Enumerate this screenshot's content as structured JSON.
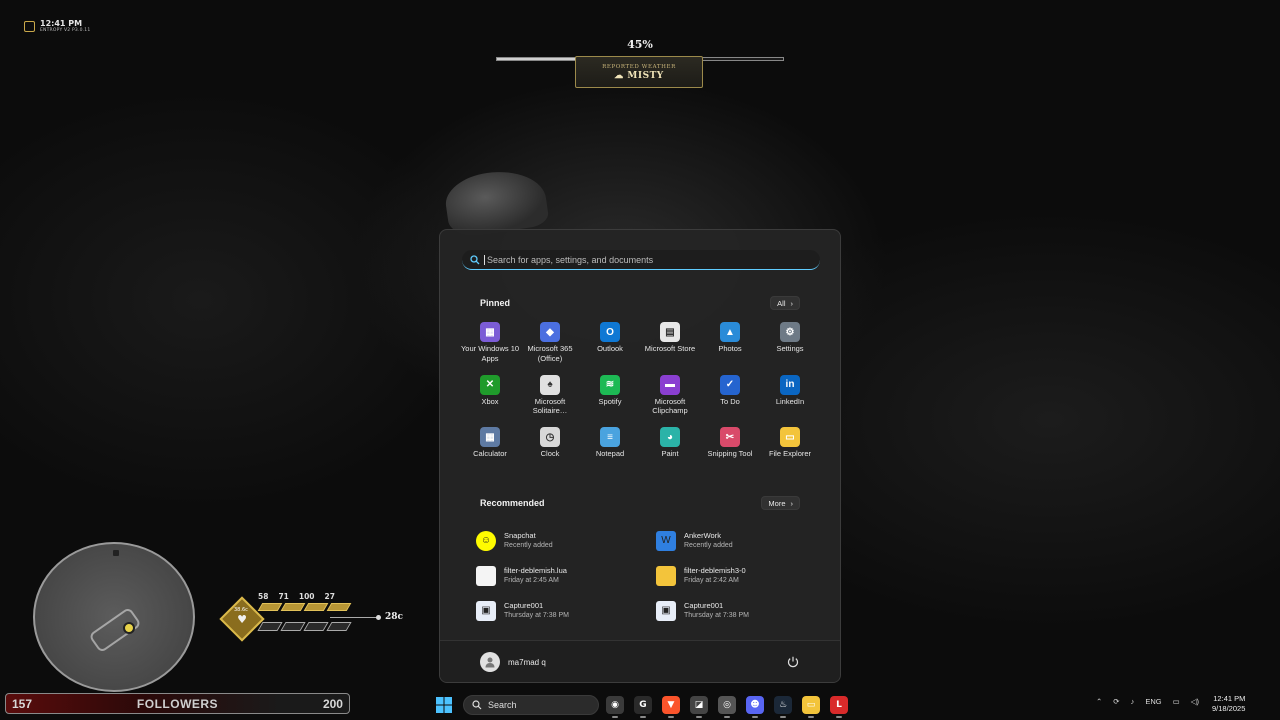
{
  "hud": {
    "time": "12:41 PM",
    "time_sub": "ENTROPY V2 P3.0.11",
    "objective_percent": "45%",
    "objective_progress": 0.45,
    "weather_caption": "REPORTED WEATHER",
    "weather_value": "MISTY",
    "minimap_temp": "38.6c",
    "stats": [
      "58",
      "71",
      "100",
      "27"
    ],
    "temperature": "28c",
    "followers_left": "157",
    "followers_label": "FOLLOWERS",
    "followers_right": "200"
  },
  "start_menu": {
    "search_placeholder": "Search for apps, settings, and documents",
    "pinned_title": "Pinned",
    "all_button": "All",
    "pinned": [
      {
        "label": "Your Windows 10 Apps",
        "icon": "windows-apps-icon",
        "color": "#7b5cd6",
        "glyph": "▦"
      },
      {
        "label": "Microsoft 365 (Office)",
        "icon": "m365-icon",
        "color": "#4b6fe0",
        "glyph": "◆"
      },
      {
        "label": "Outlook",
        "icon": "outlook-icon",
        "color": "#0f78d4",
        "glyph": "O"
      },
      {
        "label": "Microsoft Store",
        "icon": "store-icon",
        "color": "#e8e8e8",
        "glyph": "▤"
      },
      {
        "label": "Photos",
        "icon": "photos-icon",
        "color": "#2a8bd8",
        "glyph": "▲"
      },
      {
        "label": "Settings",
        "icon": "gear-icon",
        "color": "#6e7a86",
        "glyph": "⚙"
      },
      {
        "label": "Xbox",
        "icon": "xbox-icon",
        "color": "#1f9b2b",
        "glyph": "✕"
      },
      {
        "label": "Microsoft Solitaire…",
        "icon": "solitaire-icon",
        "color": "#e0e0e0",
        "glyph": "♠"
      },
      {
        "label": "Spotify",
        "icon": "spotify-icon",
        "color": "#1db954",
        "glyph": "≋"
      },
      {
        "label": "Microsoft Clipchamp",
        "icon": "clipchamp-icon",
        "color": "#8a3fd1",
        "glyph": "▬"
      },
      {
        "label": "To Do",
        "icon": "todo-icon",
        "color": "#2564cf",
        "glyph": "✓"
      },
      {
        "label": "LinkedIn",
        "icon": "linkedin-icon",
        "color": "#0a66c2",
        "glyph": "in"
      },
      {
        "label": "Calculator",
        "icon": "calculator-icon",
        "color": "#5e7aa3",
        "glyph": "▦"
      },
      {
        "label": "Clock",
        "icon": "clock-icon",
        "color": "#d8d8d8",
        "glyph": "◷"
      },
      {
        "label": "Notepad",
        "icon": "notepad-icon",
        "color": "#4aa3df",
        "glyph": "≡"
      },
      {
        "label": "Paint",
        "icon": "paint-icon",
        "color": "#2bb3a8",
        "glyph": "◕"
      },
      {
        "label": "Snipping Tool",
        "icon": "snipping-tool-icon",
        "color": "#d94a6a",
        "glyph": "✂"
      },
      {
        "label": "File Explorer",
        "icon": "folder-icon",
        "color": "#f3c43b",
        "glyph": "▭"
      }
    ],
    "recommended_title": "Recommended",
    "more_button": "More",
    "recommended": [
      {
        "name": "Snapchat",
        "sub": "Recently added",
        "icon": "snapchat-icon",
        "color": "#fffc00",
        "glyph": "☺"
      },
      {
        "name": "AnkerWork",
        "sub": "Recently added",
        "icon": "ankerwork-icon",
        "color": "#2f7fe0",
        "glyph": "W"
      },
      {
        "name": "filter-deblemish.lua",
        "sub": "Friday at 2:45 AM",
        "icon": "file-icon",
        "color": "#f4f4f4",
        "glyph": ""
      },
      {
        "name": "filter-deblemish3-0",
        "sub": "Friday at 2:42 AM",
        "icon": "folder-icon",
        "color": "#f3c43b",
        "glyph": ""
      },
      {
        "name": "Capture001",
        "sub": "Thursday at 7:38 PM",
        "icon": "image-file-icon",
        "color": "#e8eef8",
        "glyph": "▣"
      },
      {
        "name": "Capture001",
        "sub": "Thursday at 7:38 PM",
        "icon": "image-file-icon",
        "color": "#e8eef8",
        "glyph": "▣"
      }
    ],
    "user_name": "ma7mad q"
  },
  "taskbar": {
    "search_label": "Search",
    "apps": [
      {
        "icon": "app-icon-1",
        "color": "#3a3a3a",
        "glyph": "◉"
      },
      {
        "icon": "app-icon-g",
        "color": "#2a2a2a",
        "glyph": "G"
      },
      {
        "icon": "brave-icon",
        "color": "#fb542b",
        "glyph": "▼"
      },
      {
        "icon": "app-icon-box",
        "color": "#444",
        "glyph": "◪"
      },
      {
        "icon": "chromium-icon",
        "color": "#555",
        "glyph": "◎"
      },
      {
        "icon": "discord-icon",
        "color": "#5865f2",
        "glyph": "☻"
      },
      {
        "icon": "steam-icon",
        "color": "#1b2838",
        "glyph": "♨"
      },
      {
        "icon": "folder-icon",
        "color": "#f3c43b",
        "glyph": "▭"
      },
      {
        "icon": "app-icon-red",
        "color": "#d92a2a",
        "glyph": "L"
      }
    ],
    "language": "ENG",
    "time": "12:41 PM",
    "date": "9/18/2025"
  }
}
